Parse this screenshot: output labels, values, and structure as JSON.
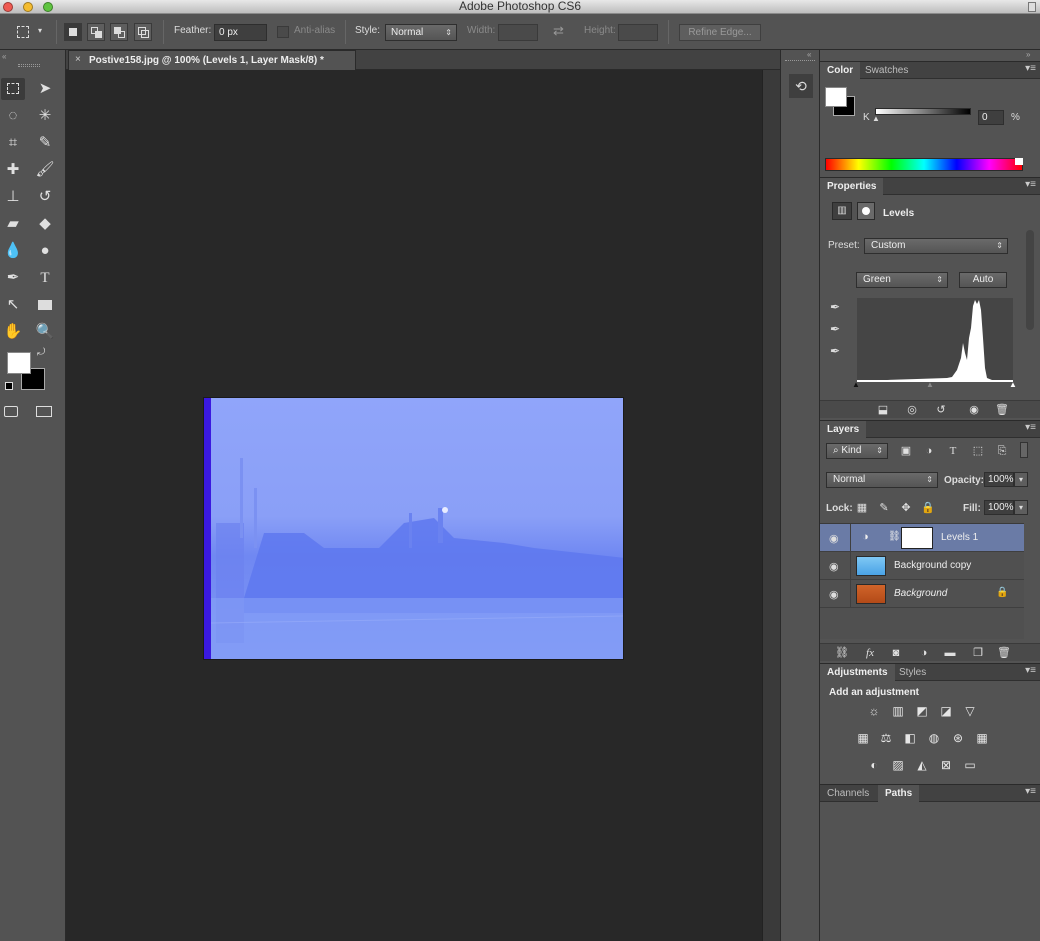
{
  "app": {
    "title": "Adobe Photoshop CS6"
  },
  "options_bar": {
    "feather_label": "Feather:",
    "feather_value": "0 px",
    "antialias_label": "Anti-alias",
    "style_label": "Style:",
    "style_value": "Normal",
    "width_label": "Width:",
    "height_label": "Height:",
    "refine_edge_label": "Refine Edge..."
  },
  "document": {
    "tab_title": "Postive158.jpg @ 100% (Levels 1, Layer Mask/8) *",
    "close_glyph": "×"
  },
  "color_panel": {
    "tabs": [
      "Color",
      "Swatches"
    ],
    "slider_label": "K",
    "slider_value": "0",
    "unit": "%",
    "k_fraction": 0
  },
  "properties_panel": {
    "tab": "Properties",
    "adjustment_name": "Levels",
    "preset_label": "Preset:",
    "preset_value": "Custom",
    "channel_value": "Green",
    "auto_label": "Auto"
  },
  "layers_panel": {
    "tab": "Layers",
    "kind_label": "Kind",
    "blend_mode": "Normal",
    "opacity_label": "Opacity:",
    "opacity_value": "100%",
    "lock_label": "Lock:",
    "fill_label": "Fill:",
    "fill_value": "100%",
    "layers": [
      {
        "name": "Levels 1",
        "selected": true
      },
      {
        "name": "Background copy",
        "selected": false
      },
      {
        "name": "Background",
        "selected": false,
        "locked": true
      }
    ]
  },
  "adjustments_panel": {
    "tabs": [
      "Adjustments",
      "Styles"
    ],
    "heading": "Add an adjustment"
  },
  "paths_panel": {
    "tabs": [
      "Channels",
      "Paths"
    ]
  },
  "colors": {
    "background": "#282828",
    "panel": "#535353",
    "selected_layer": "#6a7ba6",
    "image_blue": "#8aa0f8"
  }
}
